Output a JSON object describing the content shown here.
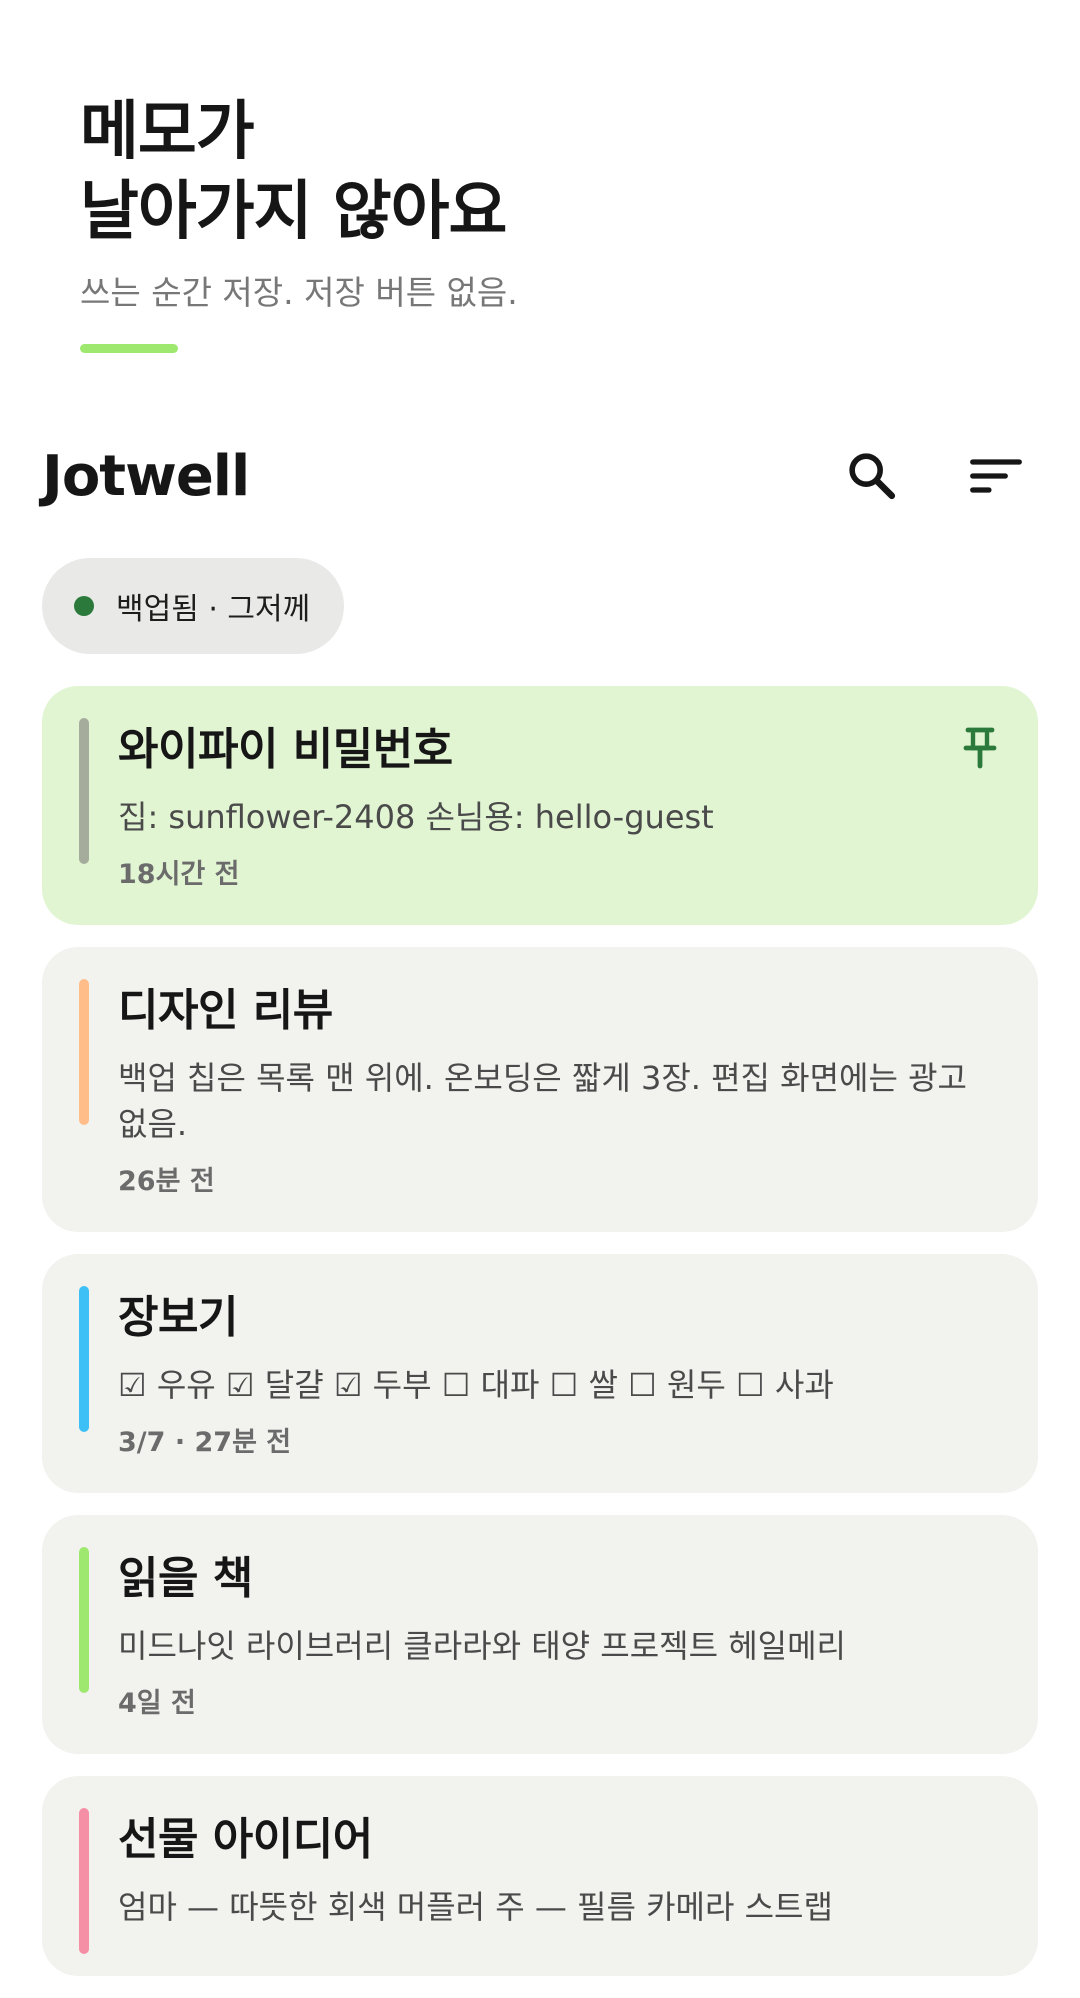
{
  "hero": {
    "title": "메모가\n날아가지 않아요",
    "subtitle": "쓰는 순간 저장. 저장 버튼 없음."
  },
  "topbar": {
    "app_title": "Jotwell",
    "search_icon": "search-icon",
    "sort_icon": "sort-icon"
  },
  "backup_chip": {
    "label": "백업됨 · 그저께",
    "status_color": "#2b7a3c"
  },
  "notes": [
    {
      "title": "와이파이 비밀번호",
      "body": "집: sunflower-2408 손님용: hello-guest",
      "meta": "18시간 전",
      "pinned": true,
      "color": "#a5ac9c"
    },
    {
      "title": "디자인 리뷰",
      "body": "백업 칩은 목록 맨 위에. 온보딩은 짧게 3장. 편집 화면에는 광고 없음.",
      "meta": "26분 전",
      "pinned": false,
      "color": "#ffbd8a"
    },
    {
      "title": "장보기",
      "body": "☑ 우유 ☑ 달걀 ☑ 두부 ☐ 대파 ☐ 쌀 ☐ 원두 ☐ 사과",
      "meta": "3/7 · 27분 전",
      "pinned": false,
      "color": "#3cc0f5"
    },
    {
      "title": "읽을 책",
      "body": "미드나잇 라이브러리 클라라와 태양 프로젝트 헤일메리",
      "meta": "4일 전",
      "pinned": false,
      "color": "#9fe870"
    },
    {
      "title": "선물 아이디어",
      "body": "엄마 — 따뜻한 회색 머플러 주 — 필름 카메라 스트랩",
      "meta": "",
      "pinned": false,
      "color": "#f58fa6"
    }
  ],
  "colors": {
    "accent": "#9fe870",
    "pinned_bg": "#e1f5d3",
    "card_bg": "#f2f3ef",
    "pin_icon": "#2b7a3c"
  }
}
